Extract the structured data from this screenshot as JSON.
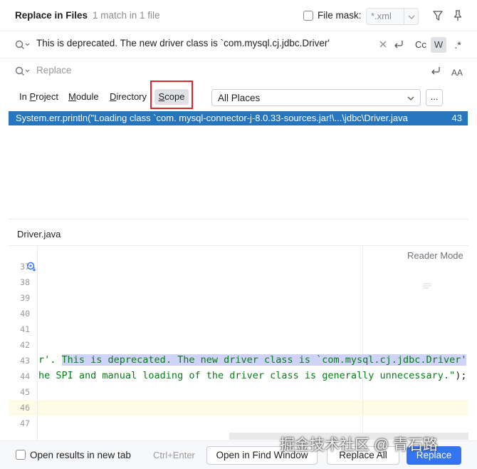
{
  "dialog": {
    "title": "Replace in Files",
    "subtitle": "1 match in 1 file",
    "file_mask_label": "File mask:",
    "file_mask_value": "*.xml"
  },
  "search": {
    "query": "This is deprecated. The new driver class is `com.mysql.cj.jdbc.Driver'",
    "match_case_label": "Cc",
    "words_label": "W",
    "regex_label": ".*"
  },
  "replace": {
    "placeholder": "Replace",
    "preserve_case_label": "AA"
  },
  "scope": {
    "tabs": [
      {
        "label": "In Project",
        "mnemonic": "P"
      },
      {
        "label": "Module",
        "mnemonic": "M"
      },
      {
        "label": "Directory",
        "mnemonic": "D"
      },
      {
        "label": "Scope",
        "mnemonic": "S"
      }
    ],
    "places_value": "All Places",
    "ellipsis_label": "..."
  },
  "results": [
    {
      "text": "System.err.println(\"Loading class `com. mysql-connector-j-8.0.33-sources.jar!\\...\\jdbc\\Driver.java",
      "line": "43"
    }
  ],
  "preview": {
    "file_name": "Driver.java",
    "reader_mode": "Reader Mode",
    "line_numbers": [
      "37",
      "38",
      "39",
      "40",
      "41",
      "42",
      "43",
      "44",
      "45",
      "46",
      "47"
    ],
    "line43_prefix": "r'. ",
    "line43_match": "This is deprecated. The new driver class is `com.mysql.cj.jdbc.Driver'",
    "line43_suffix": ". \"",
    "line44_text": "he SPI and manual loading of the driver class is generally unnecessary.\"",
    "line44_tail": ");"
  },
  "footer": {
    "open_new_tab_label": "Open results in new tab",
    "shortcut": "Ctrl+Enter",
    "open_find_window": "Open in Find Window",
    "replace_all": "Replace All",
    "replace": "Replace"
  },
  "watermark": "掘金技术社区 @ 青石路",
  "colors": {
    "selection": "#2675bf",
    "primary_button": "#3574f0",
    "highlight": "#cfd3f7",
    "string": "#067d17",
    "scope_outline": "#e0242f"
  }
}
